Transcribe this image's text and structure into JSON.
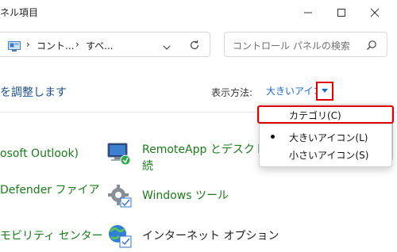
{
  "window": {
    "title": "ネル項目"
  },
  "address": {
    "crumb1": "コント...",
    "crumb2": "すべ...",
    "separator": "›"
  },
  "search": {
    "placeholder": "コントロール パネルの検索"
  },
  "page": {
    "heading": "を調整します"
  },
  "view": {
    "label": "表示方法:",
    "selected": "大きいアイコン"
  },
  "menu": {
    "items": [
      {
        "label": "カテゴリ(C)",
        "checked": false
      },
      {
        "label": "大きいアイコン(L)",
        "checked": true
      },
      {
        "label": "小さいアイコン(S)",
        "checked": false
      }
    ]
  },
  "items": {
    "left": [
      {
        "label": "osoft Outlook)"
      },
      {
        "label": "Defender ファイア"
      },
      {
        "label": "モビリティ センター"
      }
    ],
    "right": [
      {
        "label_line1": "RemoteApp とデスクト",
        "label_line2": "続"
      },
      {
        "label": "Windows ツール"
      },
      {
        "label": "インターネット オプション"
      }
    ]
  },
  "colors": {
    "accent": "#1a68c9",
    "link_green": "#1b7a1b",
    "highlight": "#e00000"
  }
}
